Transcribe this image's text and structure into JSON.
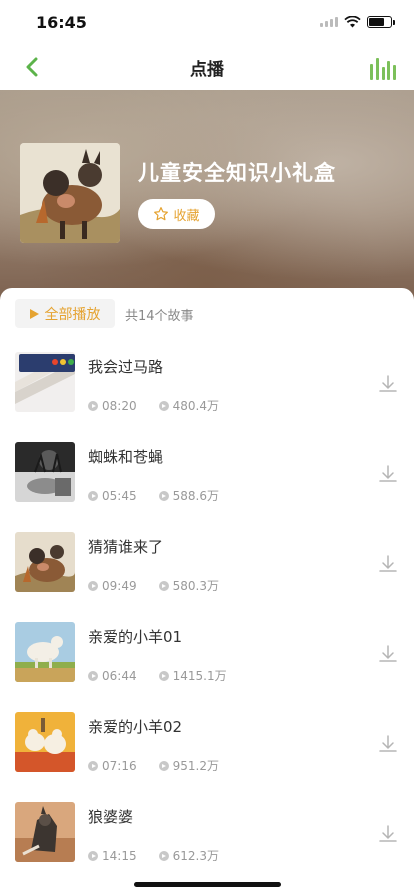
{
  "status_bar": {
    "time": "16:45"
  },
  "nav": {
    "title": "点播",
    "back_icon": "chevron-left-icon",
    "right_icon": "equalizer-icon",
    "accent_color": "#7cc05a"
  },
  "album": {
    "title": "儿童安全知识小礼盒",
    "favorite_label": "收藏"
  },
  "list_header": {
    "play_all_label": "全部播放",
    "story_count": "共14个故事"
  },
  "tracks": [
    {
      "title": "我会过马路",
      "duration": "08:20",
      "plays": "480.4万"
    },
    {
      "title": "蜘蛛和苍蝇",
      "duration": "05:45",
      "plays": "588.6万"
    },
    {
      "title": "猜猜谁来了",
      "duration": "09:49",
      "plays": "580.3万"
    },
    {
      "title": "亲爱的小羊01",
      "duration": "06:44",
      "plays": "1415.1万"
    },
    {
      "title": "亲爱的小羊02",
      "duration": "07:16",
      "plays": "951.2万"
    },
    {
      "title": "狼婆婆",
      "duration": "14:15",
      "plays": "612.3万"
    }
  ],
  "colors": {
    "accent_orange": "#e5a331",
    "accent_green": "#7cc05a"
  }
}
